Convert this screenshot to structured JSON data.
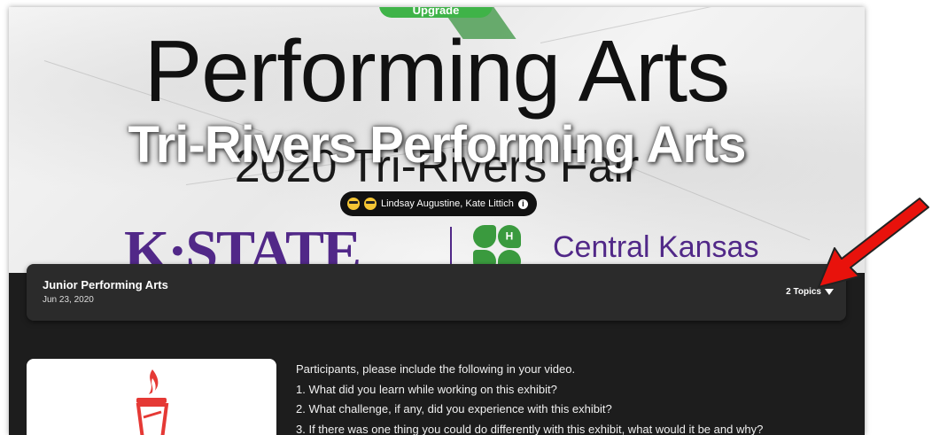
{
  "upgrade_badge": "Upgrade",
  "hero": {
    "title": "Performing Arts",
    "subtitle": "2020 Tri-Rivers Fair",
    "overlay_title": "Tri-Rivers Performing Arts",
    "authors": "Lindsay Augustine, Kate Littich",
    "logo_left": "K·STATE",
    "logo_clover_letter": "H",
    "logo_right": "Central Kansas"
  },
  "section": {
    "title": "Junior Performing Arts",
    "date": "Jun 23, 2020",
    "topics_label": "2 Topics"
  },
  "description": {
    "intro": "Participants, please include the following in your video.",
    "items": [
      "1. What did you learn while working on this exhibit?",
      "2. What challenge, if any, did you experience with this exhibit?",
      "3. If there was one thing you could do differently with this exhibit, what would it be and why?"
    ]
  },
  "colors": {
    "kstate_purple": "#512888",
    "clover_green": "#3a9a3e",
    "arrow_red": "#e8120c",
    "dark_bg": "#1d1d1d"
  },
  "icons": [
    "sunglasses-emoji-icon",
    "info-icon",
    "chevron-down-icon",
    "torch-icon",
    "red-arrow-annotation"
  ]
}
